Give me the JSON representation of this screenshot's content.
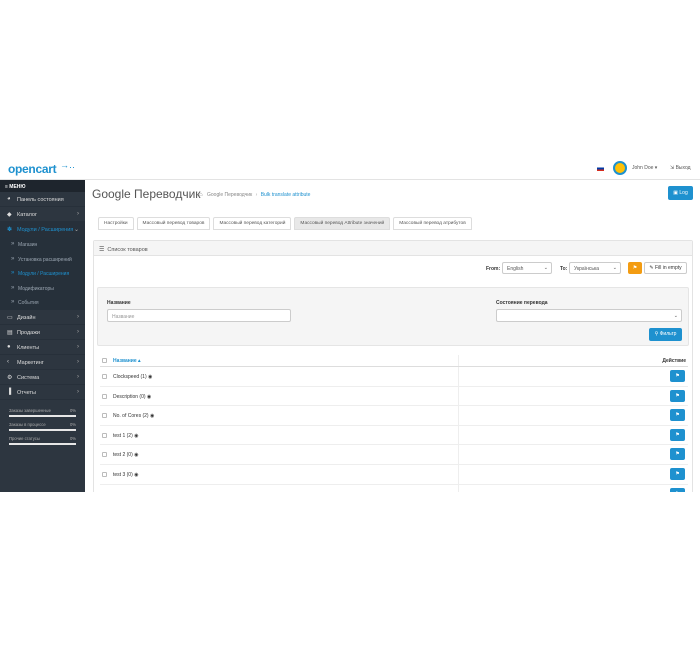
{
  "header": {
    "logo": "opencart",
    "logo_cart": "→․․",
    "user_name": "John Doe ▾",
    "logout_label": "⇲ Выход"
  },
  "sidebar": {
    "menu_label": "≡ МЕНЮ",
    "items": [
      {
        "label": "Панель состояния",
        "icon": "◕",
        "chevron": ""
      },
      {
        "label": "Каталог",
        "icon": "◆",
        "chevron": "›"
      },
      {
        "label": "Модули / Расширения",
        "icon": "✽",
        "chevron": "⌄"
      }
    ],
    "sub_items": [
      {
        "label": "Магазин"
      },
      {
        "label": "Установка расширений"
      },
      {
        "label": "Модули / Расширения"
      },
      {
        "label": "Модификаторы"
      },
      {
        "label": "События"
      }
    ],
    "items2": [
      {
        "label": "Дизайн",
        "icon": "▭",
        "chevron": "›"
      },
      {
        "label": "Продажи",
        "icon": "▤",
        "chevron": "›"
      },
      {
        "label": "Клиенты",
        "icon": "●",
        "chevron": "›"
      },
      {
        "label": "Маркетинг",
        "icon": "‹",
        "chevron": "›"
      },
      {
        "label": "Система",
        "icon": "⚙",
        "chevron": "›"
      },
      {
        "label": "Отчеты",
        "icon": "▐",
        "chevron": "›"
      }
    ],
    "stats": [
      {
        "label": "Заказы завершенные",
        "value": "0%"
      },
      {
        "label": "Заказы в процессе",
        "value": "0%"
      },
      {
        "label": "Прочие статусы",
        "value": "0%"
      }
    ]
  },
  "page": {
    "title": "Google Переводчик",
    "breadcrumb_home": "⌂",
    "breadcrumb_1": "Google Переводчик",
    "breadcrumb_sep": "›",
    "breadcrumb_2": "Bulk translate attribute",
    "log_button": "▣ Log"
  },
  "tabs": [
    {
      "label": "Настройки"
    },
    {
      "label": "Массовый перевод товаров"
    },
    {
      "label": "Массовый перевод категорий"
    },
    {
      "label": "Массовый перевод Attribute значений"
    },
    {
      "label": "Массовый перевод атрибутов"
    }
  ],
  "panel": {
    "title": "Список товаров",
    "list_icon": "☰",
    "from_label": "From:",
    "from_value": "English",
    "to_label": "To:",
    "to_value": "Українська",
    "select_arrow": "⌄",
    "translate_icon": "⚑",
    "fill_empty": "✎ Fill in empty"
  },
  "filter": {
    "name_label": "Название",
    "name_placeholder": "Название",
    "state_label": "Состояние перевода",
    "state_value": "",
    "filter_button": "⚲ Фильтр"
  },
  "table": {
    "col_name": "Название ▴",
    "col_action": "Действие",
    "row_button_icon": "⚑",
    "rows": [
      {
        "name": "Clockspeed (1) ◉"
      },
      {
        "name": "Description (0) ◉"
      },
      {
        "name": "No. of Cores (2) ◉"
      },
      {
        "name": "test 1 (2) ◉"
      },
      {
        "name": "test 2 (0) ◉"
      },
      {
        "name": "test 3 (0) ◉"
      },
      {
        "name": ""
      }
    ]
  },
  "colors": {
    "accent": "#1e91cf",
    "sidebar_bg": "#2d3640",
    "warning": "#f39c12"
  }
}
